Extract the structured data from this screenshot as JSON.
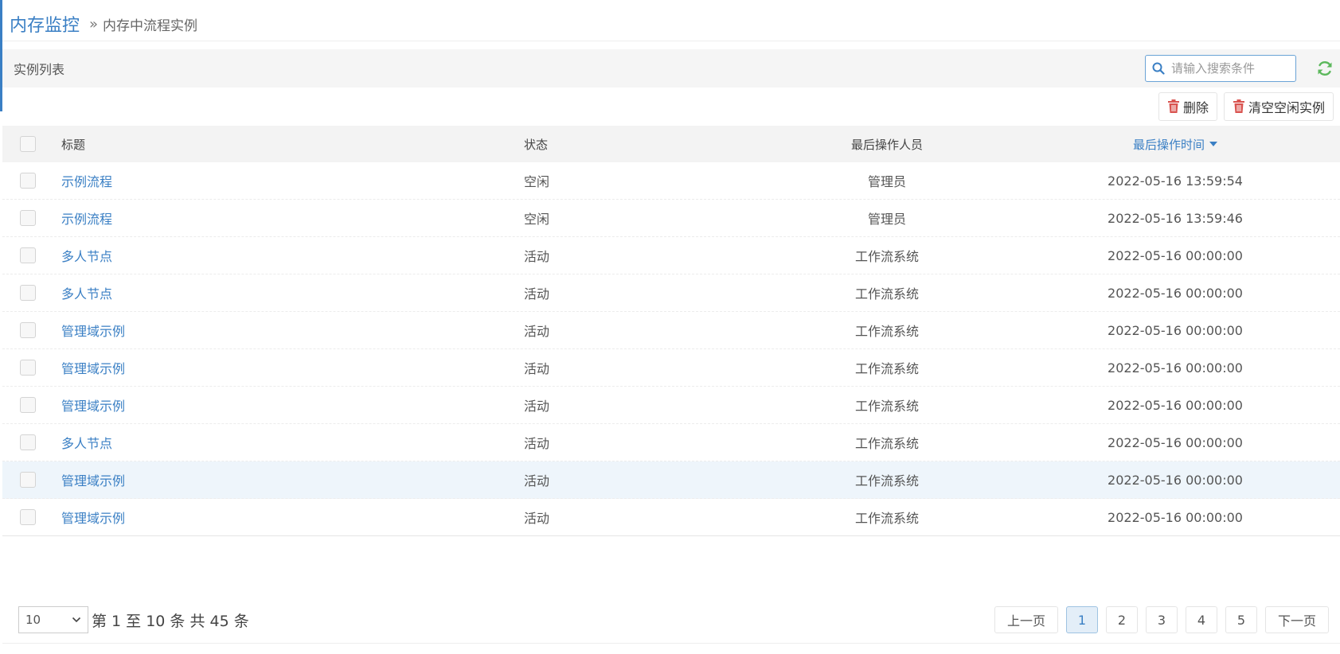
{
  "breadcrumb": {
    "main": "内存监控",
    "separator": "»",
    "sub": "内存中流程实例"
  },
  "panel": {
    "title": "实例列表",
    "search_placeholder": "请输入搜索条件",
    "search_icon": "search-icon",
    "refresh_icon": "refresh-icon"
  },
  "toolbar": {
    "delete_label": "删除",
    "clear_idle_label": "清空空闲实例",
    "trash_icon": "trash-icon"
  },
  "table": {
    "headers": {
      "title": "标题",
      "status": "状态",
      "last_operator": "最后操作人员",
      "last_time": "最后操作时间"
    },
    "sort_column": "last_time",
    "sort_direction": "desc",
    "rows": [
      {
        "title": "示例流程",
        "status": "空闲",
        "operator": "管理员",
        "time": "2022-05-16 13:59:54"
      },
      {
        "title": "示例流程",
        "status": "空闲",
        "operator": "管理员",
        "time": "2022-05-16 13:59:46"
      },
      {
        "title": "多人节点",
        "status": "活动",
        "operator": "工作流系统",
        "time": "2022-05-16 00:00:00"
      },
      {
        "title": "多人节点",
        "status": "活动",
        "operator": "工作流系统",
        "time": "2022-05-16 00:00:00"
      },
      {
        "title": "管理域示例",
        "status": "活动",
        "operator": "工作流系统",
        "time": "2022-05-16 00:00:00"
      },
      {
        "title": "管理域示例",
        "status": "活动",
        "operator": "工作流系统",
        "time": "2022-05-16 00:00:00"
      },
      {
        "title": "管理域示例",
        "status": "活动",
        "operator": "工作流系统",
        "time": "2022-05-16 00:00:00"
      },
      {
        "title": "多人节点",
        "status": "活动",
        "operator": "工作流系统",
        "time": "2022-05-16 00:00:00"
      },
      {
        "title": "管理域示例",
        "status": "活动",
        "operator": "工作流系统",
        "time": "2022-05-16 00:00:00"
      },
      {
        "title": "管理域示例",
        "status": "活动",
        "operator": "工作流系统",
        "time": "2022-05-16 00:00:00"
      }
    ]
  },
  "footer": {
    "page_size": "10",
    "page_info": "第 1 至 10 条 共 45 条",
    "prev_label": "上一页",
    "next_label": "下一页",
    "pages": [
      "1",
      "2",
      "3",
      "4",
      "5"
    ],
    "current_page": "1"
  },
  "colors": {
    "accent": "#3a7fc4",
    "refresh": "#5cb85c",
    "trash": "#d9534f"
  }
}
